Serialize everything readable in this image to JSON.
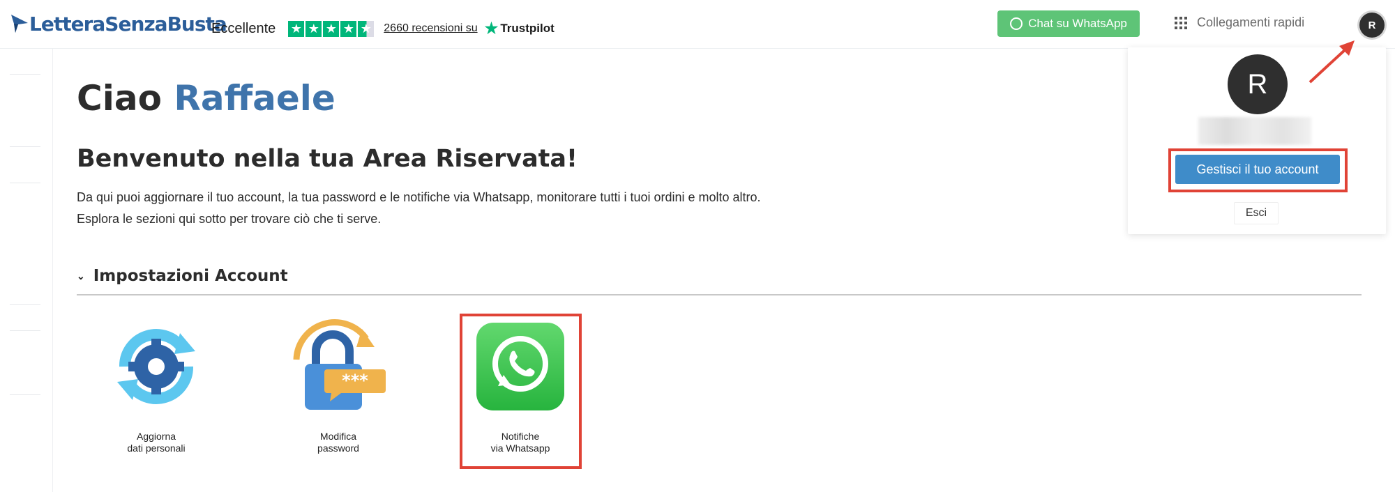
{
  "header": {
    "logo_main": "LetteraSenzaBusta",
    "trustpilot": {
      "rating_label": "Eccellente",
      "stars": 4.5,
      "reviews_link": "2660 recensioni su",
      "brand": "Trustpilot"
    },
    "whatsapp_button": "Chat su WhatsApp",
    "quick_links": "Collegamenti rapidi",
    "avatar_initial": "R"
  },
  "main": {
    "greeting_prefix": "Ciao",
    "user_name": "Raffaele",
    "welcome_title": "Benvenuto nella tua Area Riservata!",
    "intro_line1": "Da qui puoi aggiornare il tuo account, la tua password e le notifiche via Whatsapp, monitorare tutti i tuoi ordini e molto altro.",
    "intro_line2": "Esplora le sezioni qui sotto per trovare ciò che ti serve.",
    "section_title": "Impostazioni Account",
    "tiles": [
      {
        "line1": "Aggiorna",
        "line2": "dati personali",
        "icon": "gear-refresh-icon"
      },
      {
        "line1": "Modifica",
        "line2": "password",
        "icon": "lock-password-icon"
      },
      {
        "line1": "Notifiche",
        "line2": "via Whatsapp",
        "icon": "whatsapp-icon"
      }
    ]
  },
  "dropdown": {
    "avatar_initial": "R",
    "manage_button": "Gestisci il tuo account",
    "logout_button": "Esci"
  },
  "colors": {
    "accent_blue": "#3f74ab",
    "button_blue": "#3f8cc9",
    "whatsapp_green": "#5ec477",
    "trustpilot_green": "#00b67a",
    "highlight_red": "#e04336"
  }
}
